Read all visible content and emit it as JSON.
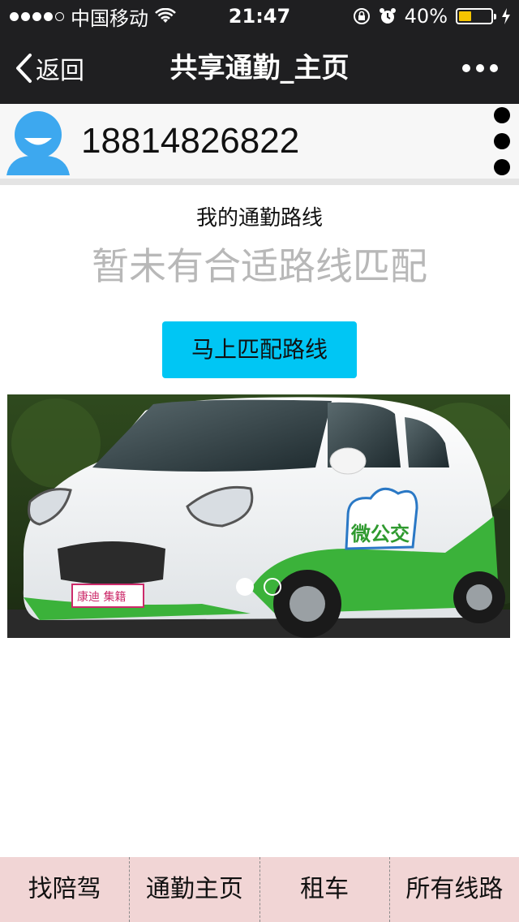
{
  "status_bar": {
    "carrier": "中国移动",
    "time": "21:47",
    "battery_percent": "40%",
    "battery_level": 0.4,
    "battery_color": "#f5c400"
  },
  "nav": {
    "back_label": "返回",
    "title": "共享通勤_主页",
    "more_icon": "more-dots-icon"
  },
  "user": {
    "phone": "18814826822",
    "avatar_icon": "user-avatar-icon",
    "menu_icon": "vertical-dots-icon"
  },
  "route": {
    "label": "我的通勤路线",
    "status": "暂未有合适路线匹配",
    "match_button": "马上匹配路线",
    "button_color": "#00c6f4"
  },
  "banner": {
    "slide_count": 2,
    "active_index": 0,
    "sticker_text": "微公交",
    "plate_text": "康迪 集籍"
  },
  "tabs": [
    {
      "label": "找陪驾"
    },
    {
      "label": "通勤主页"
    },
    {
      "label": "租车"
    },
    {
      "label": "所有线路"
    }
  ]
}
